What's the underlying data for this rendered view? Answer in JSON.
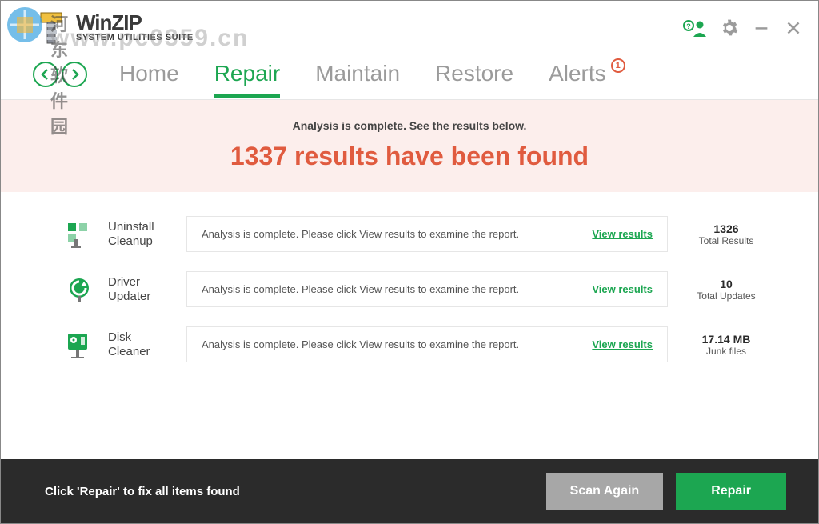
{
  "watermark": {
    "site_cn": "河东软件园",
    "site_url": "www.pc0359.cn"
  },
  "header": {
    "brand": "WinZIP",
    "brand_sub": "SYSTEM UTILITIES SUITE"
  },
  "nav": {
    "tabs": [
      {
        "label": "Home",
        "active": false
      },
      {
        "label": "Repair",
        "active": true
      },
      {
        "label": "Maintain",
        "active": false
      },
      {
        "label": "Restore",
        "active": false
      },
      {
        "label": "Alerts",
        "active": false,
        "badge": "1"
      }
    ]
  },
  "banner": {
    "small": "Analysis is complete. See the results below.",
    "big": "1337 results have been found"
  },
  "rows": [
    {
      "icon": "uninstall",
      "title": "Uninstall Cleanup",
      "msg": "Analysis is complete. Please click View results to examine the report.",
      "link": "View results",
      "count": "1326",
      "count_label": "Total Results"
    },
    {
      "icon": "driver",
      "title": "Driver Updater",
      "msg": "Analysis is complete. Please click View results to examine the report.",
      "link": "View results",
      "count": "10",
      "count_label": "Total Updates"
    },
    {
      "icon": "disk",
      "title": "Disk Cleaner",
      "msg": "Analysis is complete. Please click View results to examine the report.",
      "link": "View results",
      "count": "17.14 MB",
      "count_label": "Junk files"
    }
  ],
  "footer": {
    "text": "Click 'Repair' to fix all items found",
    "scan_label": "Scan Again",
    "repair_label": "Repair"
  }
}
